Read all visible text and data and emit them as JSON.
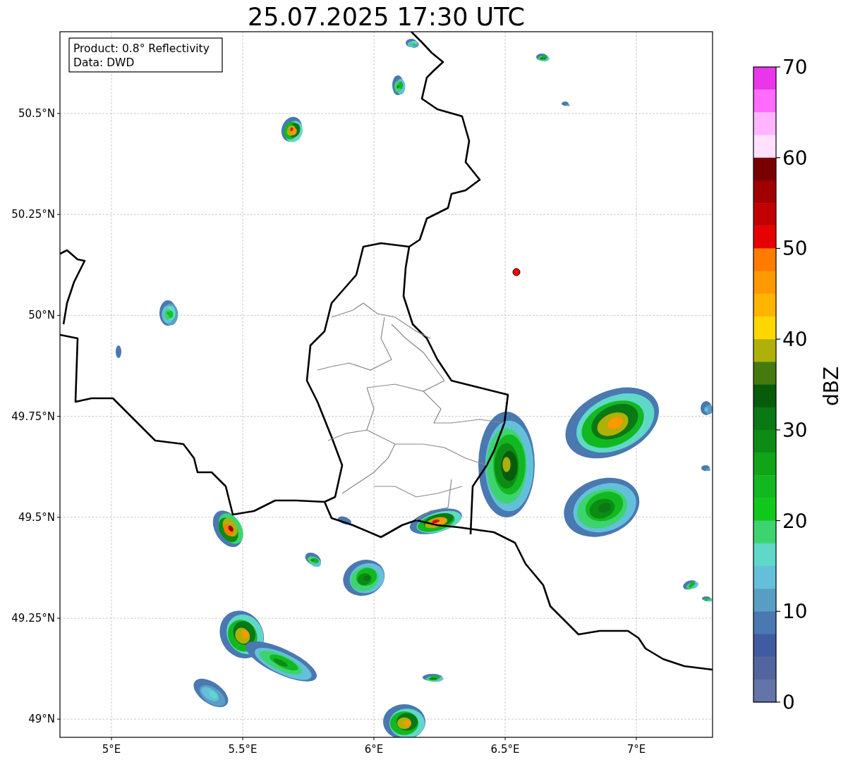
{
  "title": "25.07.2025 17:30 UTC",
  "map": {
    "annotation": [
      "Product: 0.8° Reflectivity",
      "Data: DWD"
    ],
    "xticks": [
      "5°E",
      "5.5°E",
      "6°E",
      "6.5°E",
      "7°E"
    ],
    "yticks": [
      "50.5°N",
      "50.25°N",
      "50°N",
      "49.75°N",
      "49.5°N",
      "49.25°N",
      "49°N"
    ]
  },
  "colorbar": {
    "label": "dBZ",
    "ticks": [
      "70",
      "60",
      "50",
      "40",
      "30",
      "20",
      "10",
      "0"
    ],
    "bins": [
      {
        "color": "#ea36ea"
      },
      {
        "color": "#ff6cff"
      },
      {
        "color": "#ffb4ff"
      },
      {
        "color": "#ffe1ff"
      },
      {
        "color": "#780000"
      },
      {
        "color": "#a00000"
      },
      {
        "color": "#c30000"
      },
      {
        "color": "#e60000"
      },
      {
        "color": "#ff7c00"
      },
      {
        "color": "#ff9900"
      },
      {
        "color": "#ffb400"
      },
      {
        "color": "#ffd700"
      },
      {
        "color": "#b0b00a"
      },
      {
        "color": "#457a0f"
      },
      {
        "color": "#075c0c"
      },
      {
        "color": "#0a7814"
      },
      {
        "color": "#0c8c14"
      },
      {
        "color": "#10a518"
      },
      {
        "color": "#12b820"
      },
      {
        "color": "#10c81c"
      },
      {
        "color": "#3dd470"
      },
      {
        "color": "#5fd8c8"
      },
      {
        "color": "#64c0da"
      },
      {
        "color": "#5a9dc4"
      },
      {
        "color": "#4a78b0"
      },
      {
        "color": "#405ca0"
      },
      {
        "color": "#52659f"
      },
      {
        "color": "#6374a8"
      }
    ]
  }
}
